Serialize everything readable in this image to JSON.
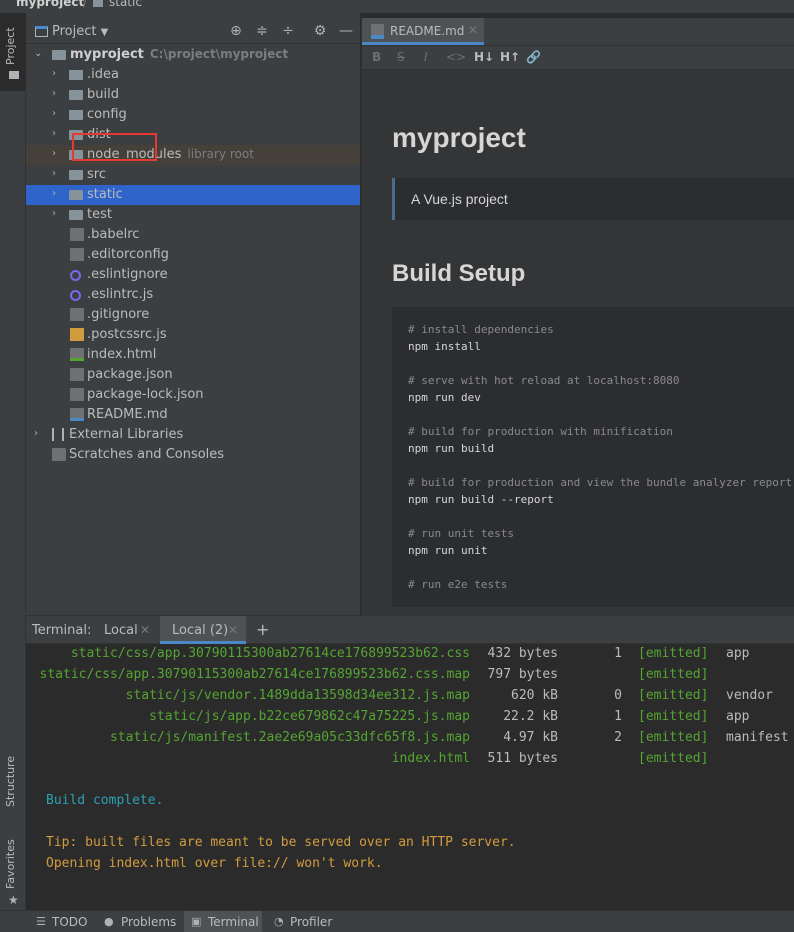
{
  "breadcrumb": {
    "project": "myproject",
    "folder": "static"
  },
  "left_strip": {
    "project_tab": "Project",
    "structure_tab": "Structure",
    "favorites_tab": "Favorites"
  },
  "project_panel": {
    "title": "Project",
    "root": {
      "name": "myproject",
      "path": "C:\\project\\myproject"
    },
    "items": [
      {
        "name": ".idea",
        "kind": "folder"
      },
      {
        "name": "build",
        "kind": "folder"
      },
      {
        "name": "config",
        "kind": "folder"
      },
      {
        "name": "dist",
        "kind": "folder"
      },
      {
        "name": "node_modules",
        "kind": "folder",
        "note": "library root"
      },
      {
        "name": "src",
        "kind": "folder"
      },
      {
        "name": "static",
        "kind": "folder"
      },
      {
        "name": "test",
        "kind": "folder"
      },
      {
        "name": ".babelrc",
        "kind": "file"
      },
      {
        "name": ".editorconfig",
        "kind": "file"
      },
      {
        "name": ".eslintignore",
        "kind": "file"
      },
      {
        "name": ".eslintrc.js",
        "kind": "file"
      },
      {
        "name": ".gitignore",
        "kind": "file"
      },
      {
        "name": ".postcssrc.js",
        "kind": "file"
      },
      {
        "name": "index.html",
        "kind": "file"
      },
      {
        "name": "package.json",
        "kind": "file"
      },
      {
        "name": "package-lock.json",
        "kind": "file"
      },
      {
        "name": "README.md",
        "kind": "file"
      }
    ],
    "external_libraries": "External Libraries",
    "scratches": "Scratches and Consoles"
  },
  "editor": {
    "tab": "README.md",
    "toolbar": {
      "bold": "B",
      "strike": "S",
      "italic": "I",
      "code": "<>",
      "h_dec": "H↓",
      "h_inc": "H↑",
      "link": "🔗"
    },
    "h1": "myproject",
    "quote": "A Vue.js project",
    "h2": "Build Setup",
    "code": [
      {
        "t": "# install dependencies",
        "c": true
      },
      {
        "t": "npm install",
        "c": false
      },
      {
        "t": "# serve with hot reload at localhost:8080",
        "c": true
      },
      {
        "t": "npm run dev",
        "c": false
      },
      {
        "t": "# build for production with minification",
        "c": true
      },
      {
        "t": "npm run build",
        "c": false
      },
      {
        "t": "# build for production and view the bundle analyzer report",
        "c": true
      },
      {
        "t": "npm run build --report",
        "c": false
      },
      {
        "t": "# run unit tests",
        "c": true
      },
      {
        "t": "npm run unit",
        "c": false
      },
      {
        "t": "# run e2e tests",
        "c": true
      }
    ]
  },
  "terminal": {
    "label": "Terminal:",
    "tabs": [
      "Local",
      "Local (2)"
    ],
    "add": "+",
    "assets": [
      {
        "file": "static/css/app.30790115300ab27614ce176899523b62.css",
        "size": "432 bytes",
        "chunk": "1",
        "status": "[emitted]",
        "name": "app"
      },
      {
        "file": "static/css/app.30790115300ab27614ce176899523b62.css.map",
        "size": "797 bytes",
        "chunk": "",
        "status": "[emitted]",
        "name": ""
      },
      {
        "file": "static/js/vendor.1489dda13598d34ee312.js.map",
        "size": "620 kB",
        "chunk": "0",
        "status": "[emitted]",
        "name": "vendor"
      },
      {
        "file": "static/js/app.b22ce679862c47a75225.js.map",
        "size": "22.2 kB",
        "chunk": "1",
        "status": "[emitted]",
        "name": "app"
      },
      {
        "file": "static/js/manifest.2ae2e69a05c33dfc65f8.js.map",
        "size": "4.97 kB",
        "chunk": "2",
        "status": "[emitted]",
        "name": "manifest"
      },
      {
        "file": "index.html",
        "size": "511 bytes",
        "chunk": "",
        "status": "[emitted]",
        "name": ""
      }
    ],
    "build_complete": "Build complete.",
    "tip1": "Tip: built files are meant to be served over an HTTP server.",
    "tip2": "Opening index.html over file:// won't work."
  },
  "bottom_bar": {
    "todo": "TODO",
    "problems": "Problems",
    "terminal": "Terminal",
    "profiler": "Profiler"
  },
  "colors": {
    "accent": "#2f65ca",
    "selected_tab": "#4a88c7",
    "green": "#55a532",
    "cyan": "#2aa1b3",
    "yellow": "#d29c3e",
    "highlight_box": "#e53935"
  }
}
